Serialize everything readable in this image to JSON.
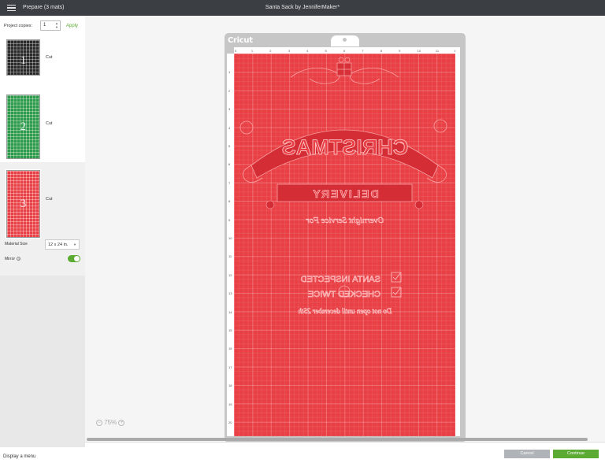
{
  "header": {
    "prepare_label": "Prepare (3 mats)",
    "project_title": "Santa Sack by JenniferMaker*"
  },
  "sidebar": {
    "project_copies_label": "Project copies:",
    "project_copies_value": "1",
    "apply_label": "Apply",
    "mats": [
      {
        "number": "1",
        "label": "Cut",
        "color": "#2a2a2a"
      },
      {
        "number": "2",
        "label": "Cut",
        "color": "#2e9a4c"
      },
      {
        "number": "3",
        "label": "Cut",
        "color": "#e84045"
      }
    ],
    "material_size_label": "Material Size",
    "material_size_value": "12 x 24 in.",
    "mirror_label": "Mirror",
    "mirror_on": true,
    "display_menu_label": "Display a menu"
  },
  "canvas": {
    "brand_logo": "Cricut",
    "zoom_level": "75%",
    "ruler_top": [
      "0",
      "1",
      "2",
      "3",
      "4",
      "5",
      "6",
      "7",
      "8",
      "9",
      "10",
      "11",
      "12"
    ],
    "ruler_left": [
      "1",
      "2",
      "3",
      "4",
      "5",
      "6",
      "7",
      "8",
      "9",
      "10",
      "11",
      "12",
      "13",
      "14",
      "15",
      "16",
      "17",
      "18",
      "19",
      "20"
    ],
    "mat_color": "#e84045"
  },
  "design_text": {
    "christmas": "CHRISTMAS",
    "delivery": "DELIVERY",
    "overnight": "Overnight Service For",
    "santa_inspected": "SANTA INSPECTED",
    "checked_twice": "CHECKED TWICE",
    "do_not_open": "Do not open until december 25th"
  },
  "footer": {
    "cancel_label": "Cancel",
    "continue_label": "Continue"
  },
  "colors": {
    "accent_green": "#5bab33",
    "topbar": "#3b3f44"
  }
}
